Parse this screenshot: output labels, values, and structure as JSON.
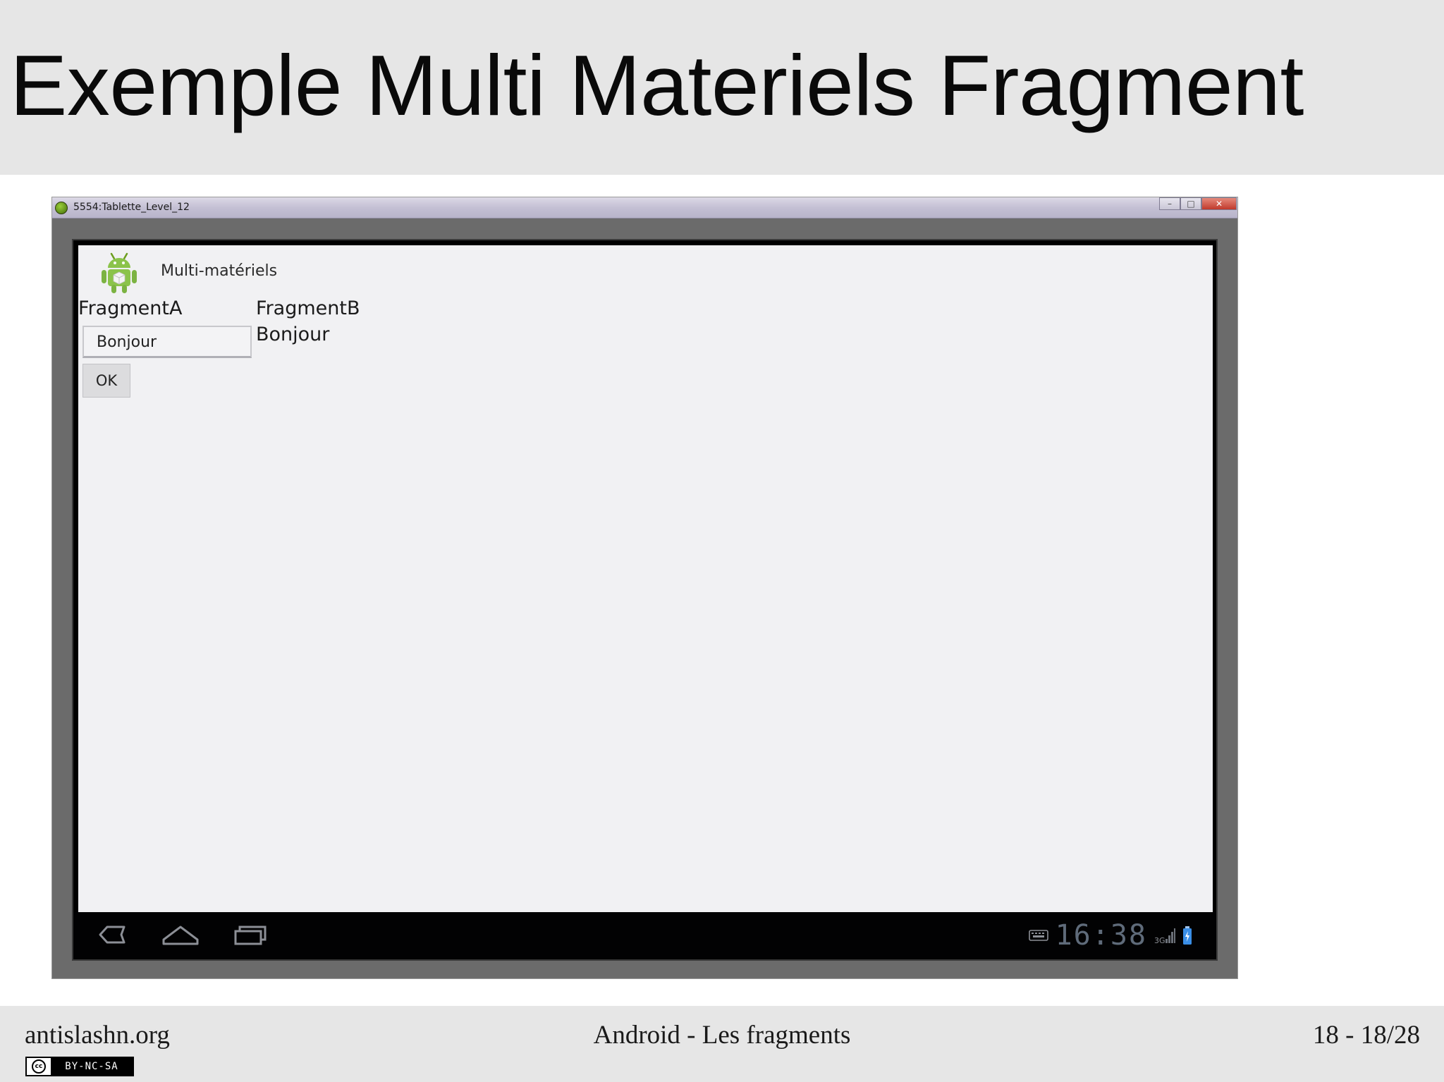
{
  "slide": {
    "title": "Exemple Multi Materiels Fragment"
  },
  "emulator": {
    "window_title": "5554:Tablette_Level_12",
    "controls": {
      "minimize_glyph": "–",
      "maximize_glyph": "□",
      "close_glyph": "✕"
    },
    "app": {
      "title": "Multi-matériels",
      "icon": "android-robot-icon"
    },
    "fragment_a": {
      "label": "FragmentA",
      "input_value": "Bonjour",
      "button_label": "OK"
    },
    "fragment_b": {
      "label": "FragmentB",
      "text": "Bonjour"
    },
    "nav_bar": {
      "buttons": [
        "back-icon",
        "home-icon",
        "recent-apps-icon"
      ],
      "clock": "16:38",
      "network": "3G"
    }
  },
  "footer": {
    "left": "antislashn.org",
    "center": "Android - Les fragments",
    "right": "18 - 18/28",
    "license_logo": "cc",
    "license_badge": "BY-NC-SA"
  },
  "colors": {
    "band_background": "#e6e6e6",
    "android_green": "#8bc34a",
    "screen_background": "#f1f1f3",
    "clock_color": "#5f6b7a"
  }
}
